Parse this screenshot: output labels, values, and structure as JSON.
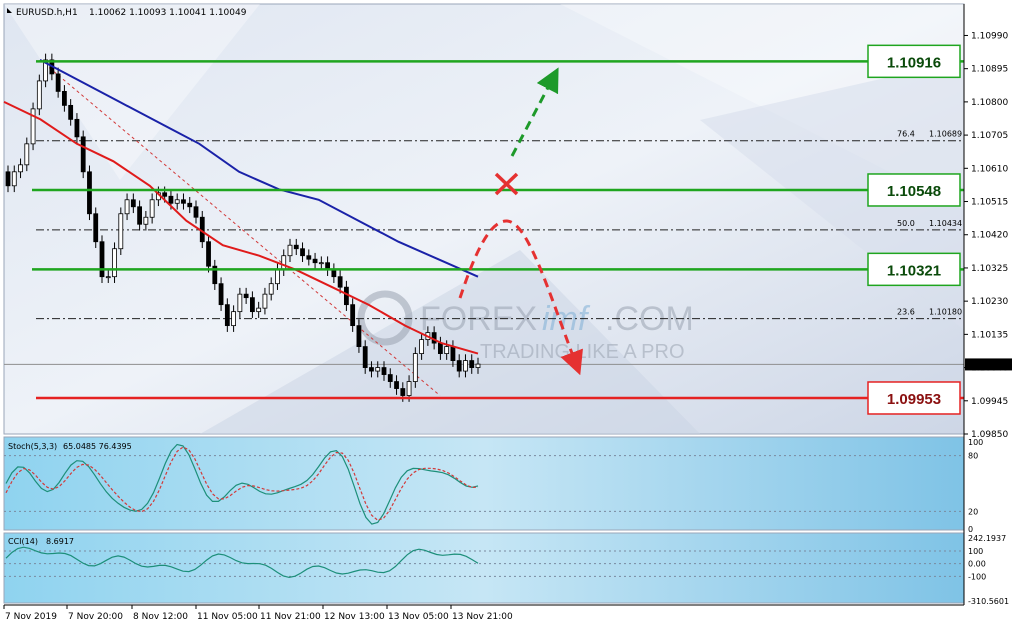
{
  "header": {
    "symbol": "EURUSD.h,H1",
    "ohlc": "1.10062 1.10093 1.10041 1.10049"
  },
  "watermark": {
    "brand_pre": "FOREX",
    "brand_mid": "imf",
    "brand_post": ".COM",
    "slogan": "TRADING LIKE A PRO"
  },
  "colors": {
    "support_resistance_green": "#1fa51f",
    "support_red": "#e52222",
    "ma_fast": "#e01b1b",
    "ma_slow": "#1a22a8",
    "arrow_up": "#1e9a2a",
    "arrow_down": "#e53131",
    "candle_bull": "#ffffff",
    "candle_bear": "#000000"
  },
  "chart_data": [
    {
      "type": "candlestick",
      "symbol": "EURUSD.h",
      "timeframe": "H1",
      "y_ticks": [
        "1.10990",
        "1.10895",
        "1.10800",
        "1.10705",
        "1.10610",
        "1.10515",
        "1.10420",
        "1.10325",
        "1.10230",
        "1.10135",
        "1.10040",
        "1.09945",
        "1.09850"
      ],
      "ylim": [
        1.0985,
        1.1108
      ],
      "x_ticks": [
        "7 Nov 2019",
        "7 Nov 20:00",
        "8 Nov 12:00",
        "11 Nov 05:00",
        "11 Nov 21:00",
        "12 Nov 13:00",
        "13 Nov 05:00",
        "13 Nov 21:00"
      ],
      "current_price": "1.10049",
      "current_price_value": 1.10049,
      "levels": [
        {
          "label": "1.10916",
          "value": 1.10916,
          "color": "green"
        },
        {
          "label": "1.10548",
          "value": 1.10548,
          "color": "green"
        },
        {
          "label": "1.10321",
          "value": 1.10321,
          "color": "green"
        },
        {
          "label": "1.09953",
          "value": 1.09953,
          "color": "red"
        }
      ],
      "fibonacci": [
        {
          "ratio": "76.4",
          "price": "1.10689",
          "value": 1.10689
        },
        {
          "ratio": "50.0",
          "price": "1.10434",
          "value": 1.10434
        },
        {
          "ratio": "23.6",
          "price": "1.10180",
          "value": 1.1018
        }
      ],
      "close_series": [
        1.1056,
        1.106,
        1.1062,
        1.1068,
        1.1078,
        1.1086,
        1.1092,
        1.1088,
        1.1083,
        1.1079,
        1.1075,
        1.107,
        1.106,
        1.1048,
        1.104,
        1.103,
        1.103,
        1.1038,
        1.1048,
        1.1052,
        1.105,
        1.1045,
        1.1047,
        1.1052,
        1.1054,
        1.1053,
        1.1051,
        1.1052,
        1.1051,
        1.105,
        1.1047,
        1.104,
        1.1033,
        1.1028,
        1.1022,
        1.1016,
        1.102,
        1.1025,
        1.1024,
        1.102,
        1.1021,
        1.1025,
        1.1028,
        1.1032,
        1.1036,
        1.1039,
        1.1038,
        1.1036,
        1.1035,
        1.1034,
        1.1034,
        1.1032,
        1.103,
        1.1027,
        1.1022,
        1.1016,
        1.101,
        1.1004,
        1.1003,
        1.1004,
        1.1002,
        1.1,
        1.0998,
        1.0996,
        1.1,
        1.1008,
        1.1012,
        1.1014,
        1.1011,
        1.1008,
        1.101,
        1.1006,
        1.1003,
        1.1006,
        1.1004,
        1.1005
      ],
      "ma_fast_series": [
        1.108,
        1.1075,
        1.1068,
        1.1063,
        1.1056,
        1.1046,
        1.1039,
        1.1036,
        1.1032,
        1.1027,
        1.1022,
        1.1016,
        1.1011,
        1.1008
      ],
      "ma_slow_series": [
        1.1092,
        1.1086,
        1.108,
        1.1074,
        1.1068,
        1.106,
        1.1055,
        1.1052,
        1.1046,
        1.104,
        1.1035,
        1.103
      ]
    },
    {
      "type": "line",
      "name": "Stoch(5,3,3) 65.0485 76.4395",
      "indicator_label": "Stoch(5,3,3)",
      "values_label": "65.0485 76.4395",
      "y_ticks": [
        "100",
        "80",
        "20",
        "0"
      ],
      "ylim": [
        0,
        100
      ]
    },
    {
      "type": "line",
      "name": "CCI(14) 8.6917",
      "indicator_label": "CCI(14)",
      "values_label": "8.6917",
      "y_ticks": [
        "242.1937",
        "100",
        "0.00",
        "-100",
        "-310.5601"
      ],
      "ylim": [
        -310.5601,
        242.1937
      ]
    }
  ]
}
